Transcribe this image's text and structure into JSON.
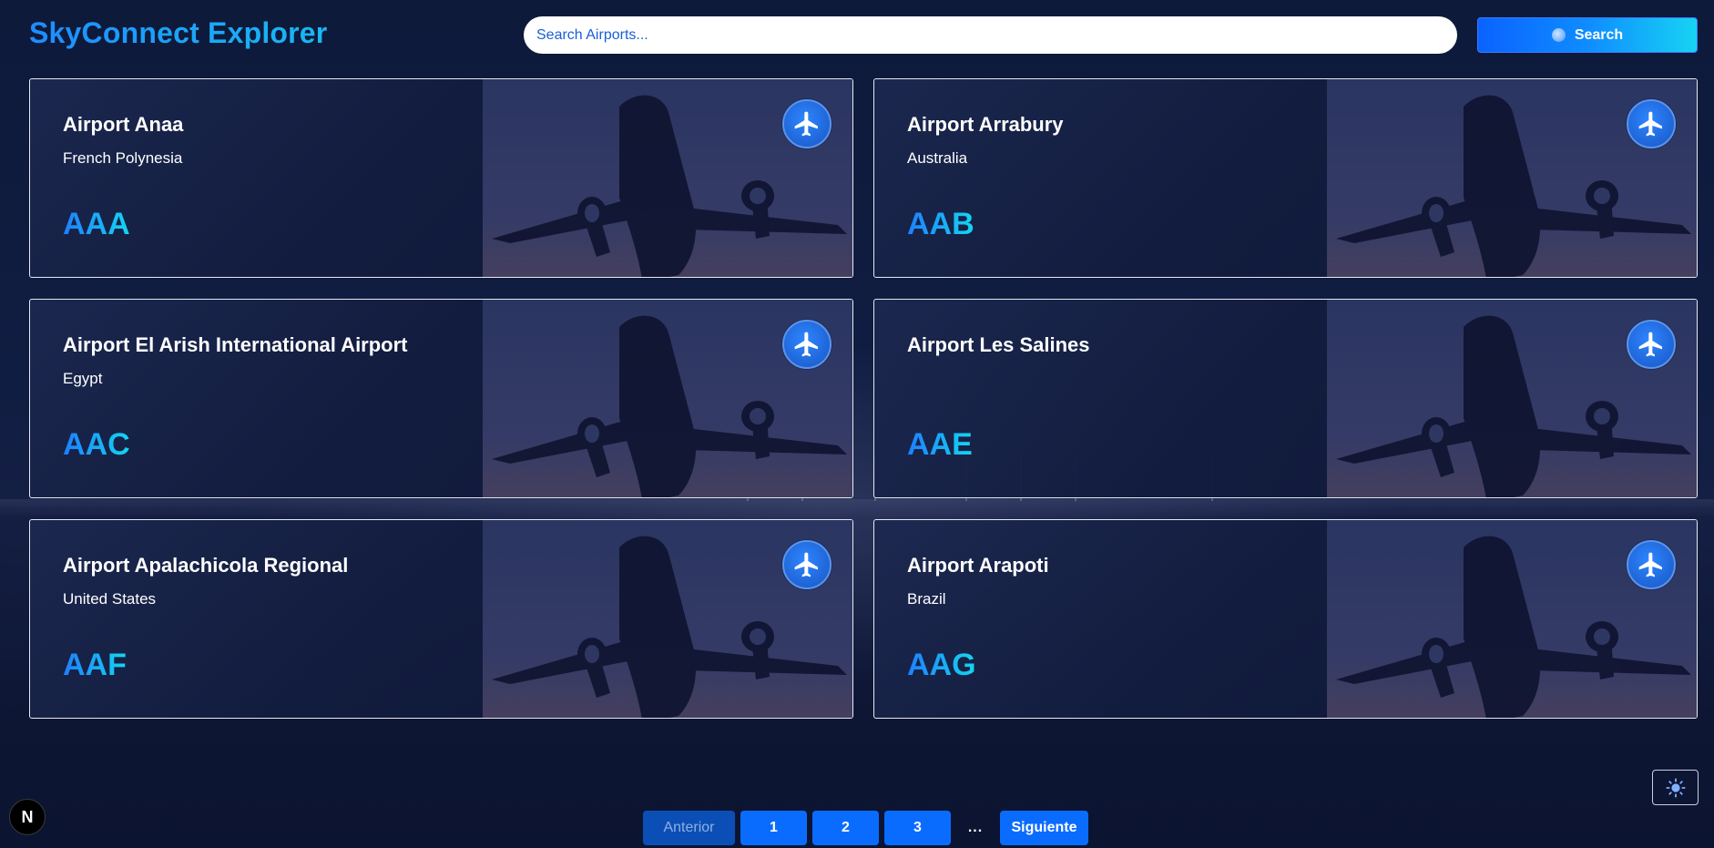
{
  "header": {
    "logo": "SkyConnect Explorer",
    "search_placeholder": "Search Airports...",
    "search_button_label": "Search"
  },
  "airports": [
    {
      "name": "Airport Anaa",
      "country": "French Polynesia",
      "code": "AAA"
    },
    {
      "name": "Airport Arrabury",
      "country": "Australia",
      "code": "AAB"
    },
    {
      "name": "Airport El Arish International Airport",
      "country": "Egypt",
      "code": "AAC"
    },
    {
      "name": "Airport Les Salines",
      "country": "",
      "code": "AAE"
    },
    {
      "name": "Airport Apalachicola Regional",
      "country": "United States",
      "code": "AAF"
    },
    {
      "name": "Airport Arapoti",
      "country": "Brazil",
      "code": "AAG"
    }
  ],
  "pagination": {
    "previous_label": "Anterior",
    "pages": [
      "1",
      "2",
      "3"
    ],
    "ellipsis": "...",
    "next_label": "Siguiente"
  },
  "badge": {
    "label": "N"
  },
  "icons": {
    "card_icon": "airplane-icon",
    "theme_toggle": "sun-icon",
    "search_button": "magnifier-icon"
  },
  "colors": {
    "accent": "#0a6cff",
    "accent_gradient_end": "#17d3f3",
    "background": "#0e1a3a"
  }
}
